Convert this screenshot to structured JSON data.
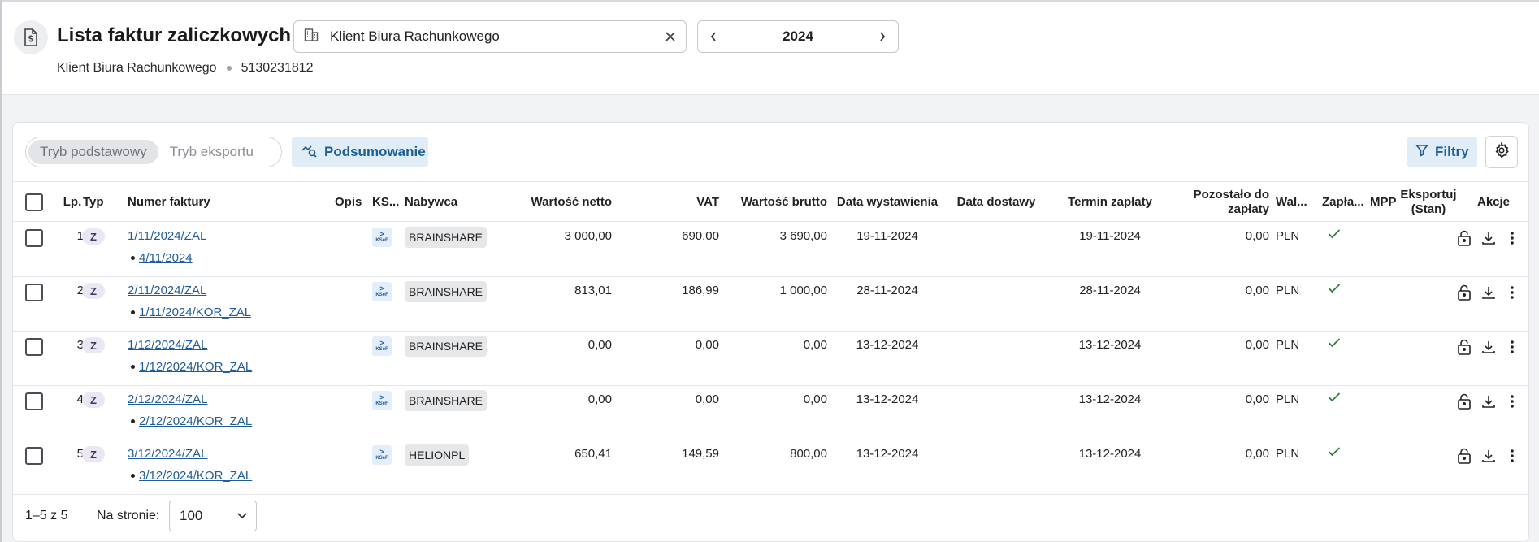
{
  "header": {
    "title": "Lista faktur zaliczkowych",
    "client_name": "Klient Biura Rachunkowego",
    "nip": "5130231812",
    "client_select_value": "Klient Biura Rachunkowego",
    "year": "2024"
  },
  "toolbar": {
    "mode_basic": "Tryb podstawowy",
    "mode_export": "Tryb eksportu",
    "summary_label": "Podsumowanie",
    "filters_label": "Filtry"
  },
  "table": {
    "columns": {
      "lp": "Lp.",
      "typ": "Typ",
      "number": "Numer faktury",
      "opis": "Opis",
      "ksef": "KS...",
      "buyer": "Nabywca",
      "net": "Wartość netto",
      "vat": "VAT",
      "gross": "Wartość brutto",
      "issue_date": "Data wystawienia",
      "delivery_date": "Data dostawy",
      "due_date": "Termin zapłaty",
      "remaining_1": "Pozostało do",
      "remaining_2": "zapłaty",
      "currency": "Wal...",
      "paid": "Zapła...",
      "mpp": "MPP",
      "export_1": "Eksportuj",
      "export_2": "(Stan)",
      "actions": "Akcje"
    },
    "rows": [
      {
        "lp": "1",
        "type": "Z",
        "number": "1/11/2024/ZAL",
        "related": "4/11/2024",
        "ksef_top": ">",
        "ksef_bottom": "KSeF",
        "buyer": "BRAINSHARE",
        "net": "3 000,00",
        "vat": "690,00",
        "gross": "3 690,00",
        "issue_date": "19-11-2024",
        "delivery_date": "",
        "due_date": "19-11-2024",
        "remaining": "0,00",
        "currency": "PLN",
        "paid": "✓"
      },
      {
        "lp": "2",
        "type": "Z",
        "number": "2/11/2024/ZAL",
        "related": "1/11/2024/KOR_ZAL",
        "ksef_top": ">",
        "ksef_bottom": "KSeF",
        "buyer": "BRAINSHARE",
        "net": "813,01",
        "vat": "186,99",
        "gross": "1 000,00",
        "issue_date": "28-11-2024",
        "delivery_date": "",
        "due_date": "28-11-2024",
        "remaining": "0,00",
        "currency": "PLN",
        "paid": "✓"
      },
      {
        "lp": "3",
        "type": "Z",
        "number": "1/12/2024/ZAL",
        "related": "1/12/2024/KOR_ZAL",
        "ksef_top": ">",
        "ksef_bottom": "KSeF",
        "buyer": "BRAINSHARE",
        "net": "0,00",
        "vat": "0,00",
        "gross": "0,00",
        "issue_date": "13-12-2024",
        "delivery_date": "",
        "due_date": "13-12-2024",
        "remaining": "0,00",
        "currency": "PLN",
        "paid": "✓"
      },
      {
        "lp": "4",
        "type": "Z",
        "number": "2/12/2024/ZAL",
        "related": "2/12/2024/KOR_ZAL",
        "ksef_top": ">",
        "ksef_bottom": "KSeF",
        "buyer": "BRAINSHARE",
        "net": "0,00",
        "vat": "0,00",
        "gross": "0,00",
        "issue_date": "13-12-2024",
        "delivery_date": "",
        "due_date": "13-12-2024",
        "remaining": "0,00",
        "currency": "PLN",
        "paid": "✓"
      },
      {
        "lp": "5",
        "type": "Z",
        "number": "3/12/2024/ZAL",
        "related": "3/12/2024/KOR_ZAL",
        "ksef_top": ">",
        "ksef_bottom": "KSeF",
        "buyer": "HELIONPL",
        "net": "650,41",
        "vat": "149,59",
        "gross": "800,00",
        "issue_date": "13-12-2024",
        "delivery_date": "",
        "due_date": "13-12-2024",
        "remaining": "0,00",
        "currency": "PLN",
        "paid": "✓"
      }
    ]
  },
  "footer": {
    "range": "1–5 z 5",
    "per_page_label": "Na stronie:",
    "per_page_value": "100"
  },
  "icons": {
    "document": "document-dollar-icon",
    "building": "building-icon",
    "close": "close-icon",
    "prev": "chevron-left-icon",
    "next": "chevron-right-icon",
    "summary": "chart-search-icon",
    "filter": "filter-icon",
    "settings": "gear-icon",
    "lock": "lock-icon",
    "download": "download-icon",
    "more": "more-vertical-icon",
    "check": "check-icon",
    "dropdown": "chevron-down-icon"
  },
  "colors": {
    "accent": "#1d5e96",
    "accent_bg": "#e0ecf6",
    "link": "#1f5c99",
    "paid_check": "#2e7d32",
    "type_badge_bg": "#ebe6f3"
  }
}
